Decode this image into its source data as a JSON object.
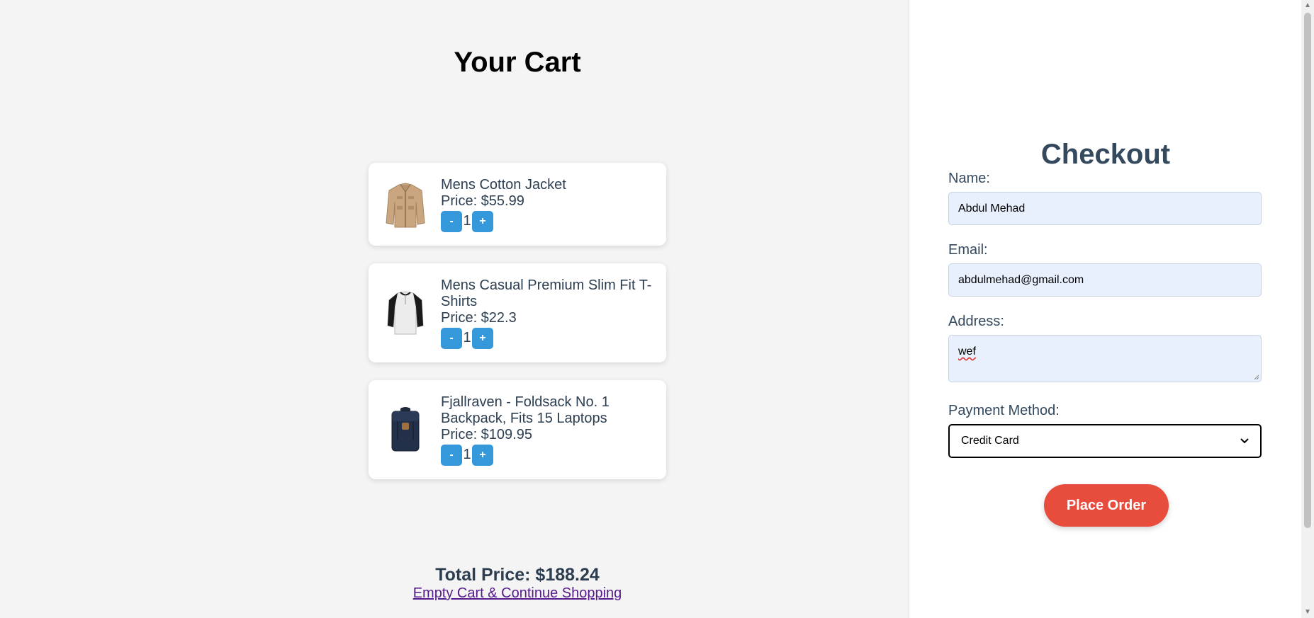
{
  "cart": {
    "title": "Your Cart",
    "items": [
      {
        "name": "Mens Cotton Jacket",
        "price": "Price: $55.99",
        "qty": "1",
        "icon": "jacket-image"
      },
      {
        "name": "Mens Casual Premium Slim Fit T-Shirts",
        "price": "Price: $22.3",
        "qty": "1",
        "icon": "tshirt-image"
      },
      {
        "name": "Fjallraven - Foldsack No. 1 Backpack, Fits 15 Laptops",
        "price": "Price: $109.95",
        "qty": "1",
        "icon": "backpack-image"
      }
    ],
    "decrement_label": "-",
    "increment_label": "+",
    "total": "Total Price: $188.24",
    "empty_link": "Empty Cart & Continue Shopping"
  },
  "checkout": {
    "title": "Checkout",
    "name_label": "Name:",
    "name_value": "Abdul Mehad",
    "email_label": "Email:",
    "email_value": "abdulmehad@gmail.com",
    "address_label": "Address:",
    "address_value": "wef",
    "payment_label": "Payment Method:",
    "payment_value": "Credit Card",
    "place_order": "Place Order"
  },
  "colors": {
    "qty_button": "#3498db",
    "place_order": "#e74c3c",
    "heading": "#34495e",
    "input_bg": "#e8f0fe"
  }
}
